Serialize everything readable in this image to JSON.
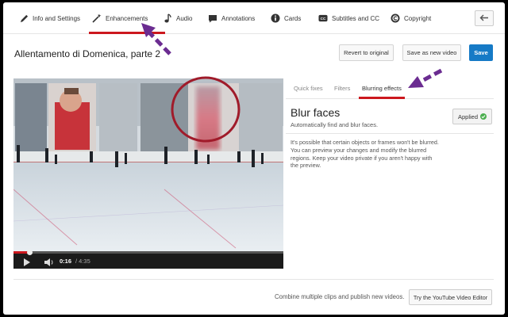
{
  "nav": {
    "items": [
      {
        "label": "Info and Settings",
        "icon": "pencil-icon"
      },
      {
        "label": "Enhancements",
        "icon": "magic-wand-icon"
      },
      {
        "label": "Audio",
        "icon": "music-note-icon"
      },
      {
        "label": "Annotations",
        "icon": "speech-bubble-icon"
      },
      {
        "label": "Cards",
        "icon": "info-circle-icon"
      },
      {
        "label": "Subtitles and CC",
        "icon": "cc-icon"
      },
      {
        "label": "Copyright",
        "icon": "copyright-icon"
      }
    ],
    "back_icon": "back-arrow-icon"
  },
  "header": {
    "title": "Allentamento di Domenica, parte 2",
    "revert_label": "Revert to original",
    "save_new_label": "Save as new video",
    "save_label": "Save"
  },
  "player": {
    "time_current": "0:16",
    "time_total": "/ 4:35",
    "progress": 0.058
  },
  "tabs": [
    {
      "label": "Quick fixes",
      "active": false
    },
    {
      "label": "Filters",
      "active": false
    },
    {
      "label": "Blurring effects",
      "active": true
    }
  ],
  "blur": {
    "heading": "Blur faces",
    "subheading": "Automatically find and blur faces.",
    "applied_label": "Applied",
    "note": "It's possible that certain objects or frames won't be blurred. You can preview your changes and modify the blurred regions. Keep your video private if you aren't happy with the preview."
  },
  "footer": {
    "text": "Combine multiple clips and publish new videos.",
    "button_label": "Try the YouTube Video Editor"
  },
  "colors": {
    "accent_red": "#cc181e",
    "save_blue": "#167ac6",
    "annotation_purple": "#6b2c91",
    "circle_red": "#a01b2a"
  }
}
